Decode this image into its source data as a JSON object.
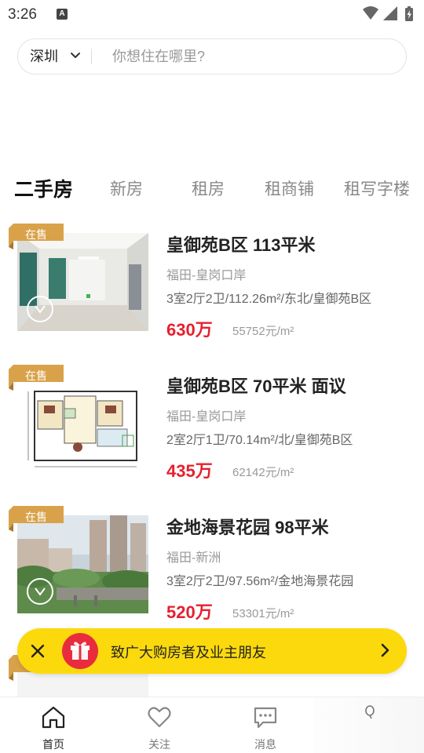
{
  "status_bar": {
    "time": "3:26",
    "notification_icon": "A"
  },
  "search": {
    "city": "深圳",
    "placeholder": "你想住在哪里?"
  },
  "tabs": [
    {
      "label": "二手房",
      "active": true
    },
    {
      "label": "新房",
      "active": false
    },
    {
      "label": "租房",
      "active": false
    },
    {
      "label": "租商铺",
      "active": false
    },
    {
      "label": "租写字楼",
      "active": false
    }
  ],
  "listings": [
    {
      "badge": "在售",
      "title": "皇御苑B区 113平米",
      "area": "福田-皇岗口岸",
      "spec": "3室2厅2卫/112.26m²/东北/皇御苑B区",
      "price": "630万",
      "unit_price": "55752元/m²",
      "vr": true,
      "image": "interior-photo"
    },
    {
      "badge": "在售",
      "title": "皇御苑B区 70平米 面议",
      "area": "福田-皇岗口岸",
      "spec": "2室2厅1卫/70.14m²/北/皇御苑B区",
      "price": "435万",
      "unit_price": "62142元/m²",
      "vr": false,
      "image": "floor-plan"
    },
    {
      "badge": "在售",
      "title": "金地海景花园 98平米",
      "area": "福田-新洲",
      "spec": "3室2厅2卫/97.56m²/金地海景花园",
      "price": "520万",
      "unit_price": "53301元/m²",
      "vr": true,
      "image": "building-photo"
    }
  ],
  "promo": {
    "text": "致广大购房者及业主朋友",
    "colors": {
      "background": "#fbd90d",
      "gift": "#e92c3d"
    }
  },
  "bottom_nav": [
    {
      "label": "首页",
      "icon": "home-icon",
      "active": true
    },
    {
      "label": "关注",
      "icon": "heart-icon",
      "active": false
    },
    {
      "label": "消息",
      "icon": "chat-icon",
      "active": false
    }
  ],
  "colors": {
    "price": "#e5202e",
    "badge": "#d9a24a"
  }
}
